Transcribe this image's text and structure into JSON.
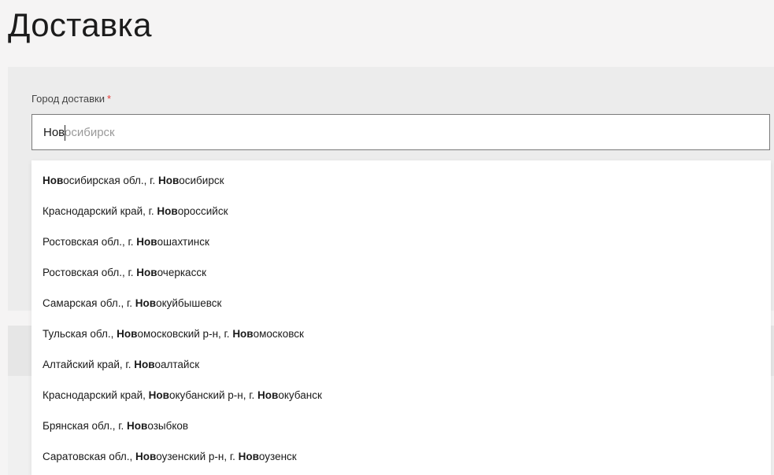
{
  "page": {
    "title": "Доставка"
  },
  "delivery_form": {
    "city_label": "Город доставки",
    "required_mark": "*",
    "city_input": {
      "typed_value": "Нов",
      "autocomplete_hint": "осибирск"
    }
  },
  "suggestions": [
    {
      "parts": [
        {
          "t": "Нов",
          "b": true
        },
        {
          "t": "осибирская обл., г. ",
          "b": false
        },
        {
          "t": "Нов",
          "b": true
        },
        {
          "t": "осибирск",
          "b": false
        }
      ]
    },
    {
      "parts": [
        {
          "t": "Краснодарский край, г. ",
          "b": false
        },
        {
          "t": "Нов",
          "b": true
        },
        {
          "t": "ороссийск",
          "b": false
        }
      ]
    },
    {
      "parts": [
        {
          "t": "Ростовская обл., г. ",
          "b": false
        },
        {
          "t": "Нов",
          "b": true
        },
        {
          "t": "ошахтинск",
          "b": false
        }
      ]
    },
    {
      "parts": [
        {
          "t": "Ростовская обл., г. ",
          "b": false
        },
        {
          "t": "Нов",
          "b": true
        },
        {
          "t": "очеркасск",
          "b": false
        }
      ]
    },
    {
      "parts": [
        {
          "t": "Самарская обл., г. ",
          "b": false
        },
        {
          "t": "Нов",
          "b": true
        },
        {
          "t": "окуйбышевск",
          "b": false
        }
      ]
    },
    {
      "parts": [
        {
          "t": "Тульская обл., ",
          "b": false
        },
        {
          "t": "Нов",
          "b": true
        },
        {
          "t": "омосковский р-н, г. ",
          "b": false
        },
        {
          "t": "Нов",
          "b": true
        },
        {
          "t": "омосковск",
          "b": false
        }
      ]
    },
    {
      "parts": [
        {
          "t": "Алтайский край, г. ",
          "b": false
        },
        {
          "t": "Нов",
          "b": true
        },
        {
          "t": "оалтайск",
          "b": false
        }
      ]
    },
    {
      "parts": [
        {
          "t": "Краснодарский край, ",
          "b": false
        },
        {
          "t": "Нов",
          "b": true
        },
        {
          "t": "окубанский р-н, г. ",
          "b": false
        },
        {
          "t": "Нов",
          "b": true
        },
        {
          "t": "окубанск",
          "b": false
        }
      ]
    },
    {
      "parts": [
        {
          "t": "Брянская обл., г. ",
          "b": false
        },
        {
          "t": "Нов",
          "b": true
        },
        {
          "t": "озыбков",
          "b": false
        }
      ]
    },
    {
      "parts": [
        {
          "t": "Саратовская обл., ",
          "b": false
        },
        {
          "t": "Нов",
          "b": true
        },
        {
          "t": "оузенский р-н, г. ",
          "b": false
        },
        {
          "t": "Нов",
          "b": true
        },
        {
          "t": "оузенск",
          "b": false
        }
      ]
    }
  ],
  "colors": {
    "required_mark": "#e53935",
    "input_border": "#7a7a7a",
    "panel_background": "#ececec",
    "page_background": "#f5f4f4"
  }
}
